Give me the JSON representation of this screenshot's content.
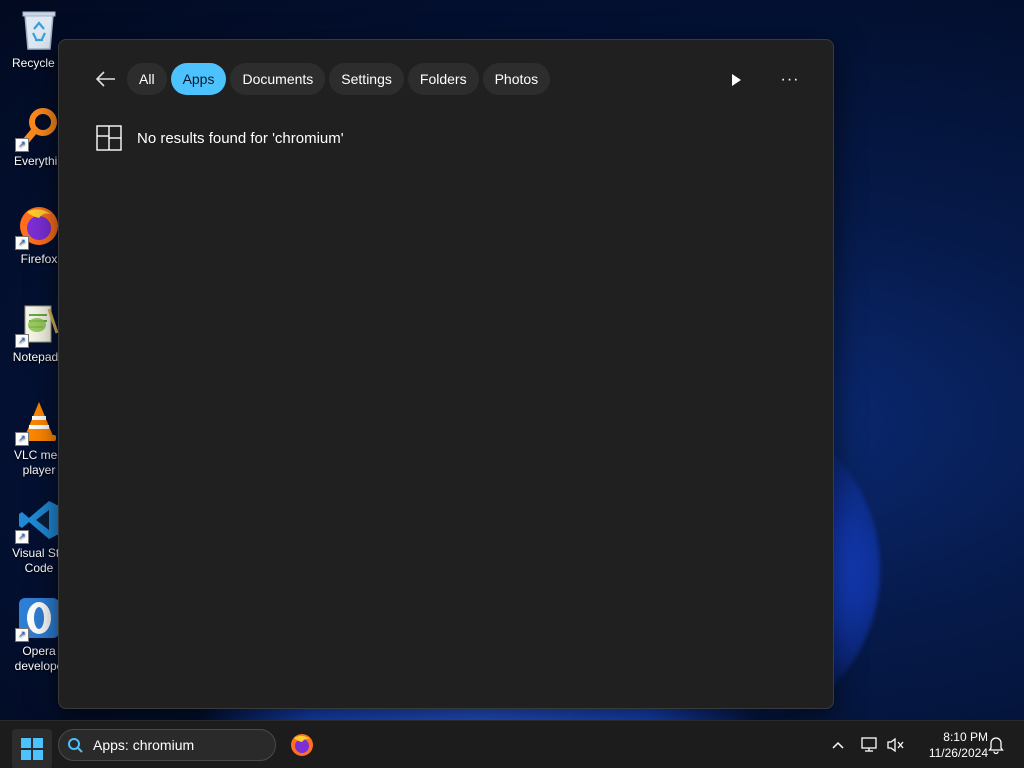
{
  "desktop": {
    "icons": [
      {
        "label": "Recycle B",
        "icon": "recycle-bin-icon"
      },
      {
        "label": "Everythin",
        "icon": "everything-search-icon"
      },
      {
        "label": "Firefox",
        "icon": "firefox-icon"
      },
      {
        "label": "Notepad+",
        "icon": "notepad-plus-plus-icon"
      },
      {
        "label": "VLC med\nplayer",
        "label_line1": "VLC med",
        "label_line2": "player",
        "icon": "vlc-icon"
      },
      {
        "label_line1": "Visual Stu",
        "label_line2": "Code",
        "icon": "vscode-icon"
      },
      {
        "label_line1": "Opera",
        "label_line2": "develope",
        "icon": "opera-icon"
      }
    ]
  },
  "search_flyout": {
    "filters": [
      {
        "label": "All",
        "active": false
      },
      {
        "label": "Apps",
        "active": true
      },
      {
        "label": "Documents",
        "active": false
      },
      {
        "label": "Settings",
        "active": false
      },
      {
        "label": "Folders",
        "active": false
      },
      {
        "label": "Photos",
        "active": false
      }
    ],
    "no_results_text": "No results found for 'chromium'"
  },
  "taskbar": {
    "search_text": "Apps: chromium",
    "time": "8:10 PM",
    "date": "11/26/2024"
  },
  "colors": {
    "accent": "#4cc2ff",
    "flyout_bg": "#202020",
    "pill_bg": "#2d2d2d",
    "taskbar_bg": "#1c1c1c"
  }
}
